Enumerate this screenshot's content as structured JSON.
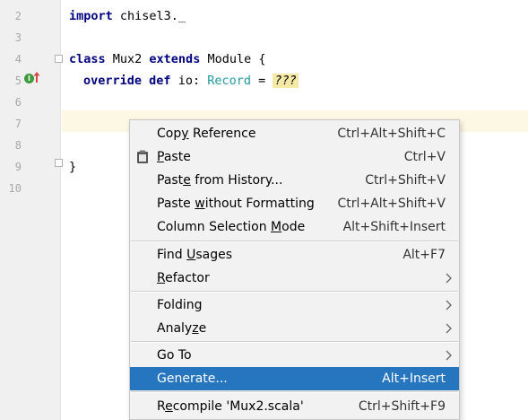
{
  "editor": {
    "lines": [
      {
        "num": "2"
      },
      {
        "num": "3"
      },
      {
        "num": "4"
      },
      {
        "num": "5"
      },
      {
        "num": "6"
      },
      {
        "num": "7"
      },
      {
        "num": "8"
      },
      {
        "num": "9"
      },
      {
        "num": "10"
      }
    ],
    "code": {
      "import_kw": "import",
      "import_rest": " chisel3._",
      "class_kw": "class",
      "class_name": " Mux2 ",
      "extends_kw": "extends",
      "parent": " Module {",
      "override_kw": "override",
      "def_kw": "def",
      "io_text": " io: ",
      "record_type": "Record",
      "eq": " = ",
      "todo": "???",
      "close_brace": "}"
    },
    "gutter_icons": [
      "implements-icon",
      "override-arrow-icon",
      "fold-marker-icon"
    ]
  },
  "context_menu": {
    "items": [
      {
        "before": "Cop",
        "mnemonic": "y",
        "after": " Reference",
        "shortcut": "Ctrl+Alt+Shift+C"
      },
      {
        "before": "",
        "mnemonic": "P",
        "after": "aste",
        "shortcut": "Ctrl+V",
        "icon": "clipboard-icon"
      },
      {
        "before": "Past",
        "mnemonic": "e",
        "after": " from History...",
        "shortcut": "Ctrl+Shift+V"
      },
      {
        "before": "Paste ",
        "mnemonic": "w",
        "after": "ithout Formatting",
        "shortcut": "Ctrl+Alt+Shift+V"
      },
      {
        "before": "Column Selection ",
        "mnemonic": "M",
        "after": "ode",
        "shortcut": "Alt+Shift+Insert"
      },
      {
        "before": "Find ",
        "mnemonic": "U",
        "after": "sages",
        "shortcut": "Alt+F7"
      },
      {
        "before": "",
        "mnemonic": "R",
        "after": "efactor",
        "submenu": true
      },
      {
        "before": "Folding",
        "mnemonic": "",
        "after": "",
        "submenu": true
      },
      {
        "before": "Analy",
        "mnemonic": "z",
        "after": "e",
        "submenu": true
      },
      {
        "before": "Go To",
        "mnemonic": "",
        "after": "",
        "submenu": true
      },
      {
        "before": "Generate...",
        "mnemonic": "",
        "after": "",
        "shortcut": "Alt+Insert",
        "selected": true
      },
      {
        "before": "R",
        "mnemonic": "e",
        "after": "compile 'Mux2.scala'",
        "shortcut": "Ctrl+Shift+F9"
      }
    ]
  },
  "colors": {
    "keyword": "#000080",
    "type": "#20999d",
    "selection": "#2675bf",
    "current_line": "#fcf8e3",
    "todo_highlight": "#f5eaa5"
  }
}
